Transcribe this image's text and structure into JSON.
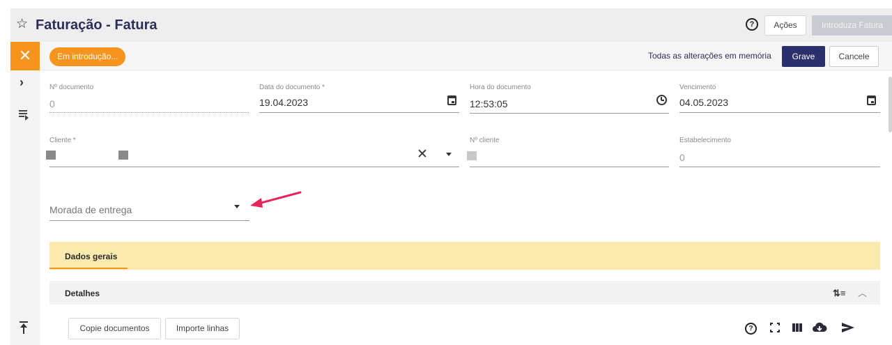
{
  "header": {
    "title": "Faturação - Fatura",
    "actions_label": "Ações",
    "primary_label": "Introduza Fatura"
  },
  "rail": {
    "close_icon": "close-icon",
    "expand_icon": "chevron-right-icon",
    "list_icon": "playlist-icon",
    "top_icon": "scroll-top-icon"
  },
  "status": {
    "pill": "Em introdução...",
    "saved_text": "Todas as alterações em memória",
    "save_label": "Grave",
    "cancel_label": "Cancele"
  },
  "form": {
    "doc_number": {
      "label": "Nº documento",
      "value": "0"
    },
    "doc_date": {
      "label": "Data do documento *",
      "value": "19.04.2023"
    },
    "doc_time": {
      "label": "Hora do documento",
      "value": "12:53:05"
    },
    "due_date": {
      "label": "Vencimento",
      "value": "04.05.2023"
    },
    "client": {
      "label": "Cliente *",
      "clear_label": "✕"
    },
    "client_number": {
      "label": "Nº cliente"
    },
    "establishment": {
      "label": "Estabelecimento",
      "value": "0"
    },
    "delivery_address": {
      "placeholder": "Morada de entrega"
    }
  },
  "tabs": [
    {
      "label": "Dados gerais",
      "active": true
    }
  ],
  "details": {
    "title": "Detalhes"
  },
  "lines_toolbar": {
    "copy_label": "Copie documentos",
    "import_label": "Importe linhas",
    "icons": [
      "help-icon",
      "fullscreen-icon",
      "columns-icon",
      "cloud-download-icon",
      "send-icon"
    ]
  },
  "colors": {
    "accent": "#f7941d",
    "primary": "#2b2f6b",
    "tab_bar": "#fdeaae",
    "annotation_arrow": "#e8245a"
  }
}
